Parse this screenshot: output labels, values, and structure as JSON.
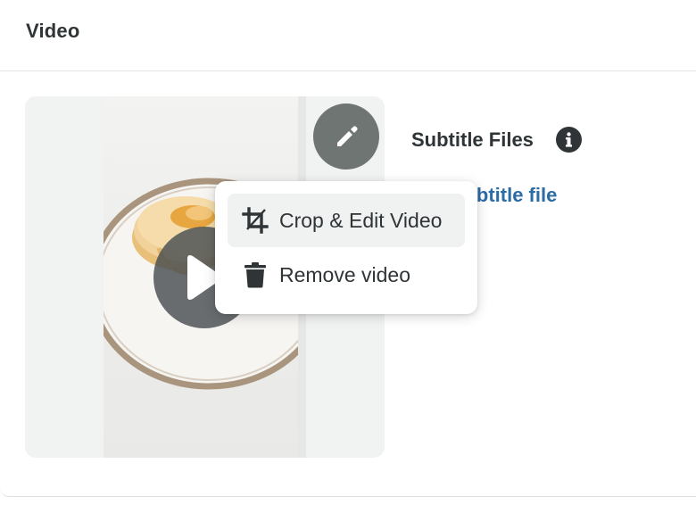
{
  "section": {
    "title": "Video"
  },
  "video": {
    "play_icon": "play-icon",
    "edit_icon": "pencil-icon"
  },
  "subtitles": {
    "title": "Subtitle Files",
    "info_icon": "info-icon",
    "add_link": "Add a subtitle file"
  },
  "menu": {
    "items": [
      {
        "label": "Crop & Edit Video",
        "icon": "crop-icon",
        "active": true
      },
      {
        "label": "Remove video",
        "icon": "trash-icon",
        "active": false
      }
    ]
  },
  "colors": {
    "text": "#2f3437",
    "link": "#2c6ca6",
    "menu_hover": "#f0f1f1",
    "edit_button": "#6f7573"
  }
}
